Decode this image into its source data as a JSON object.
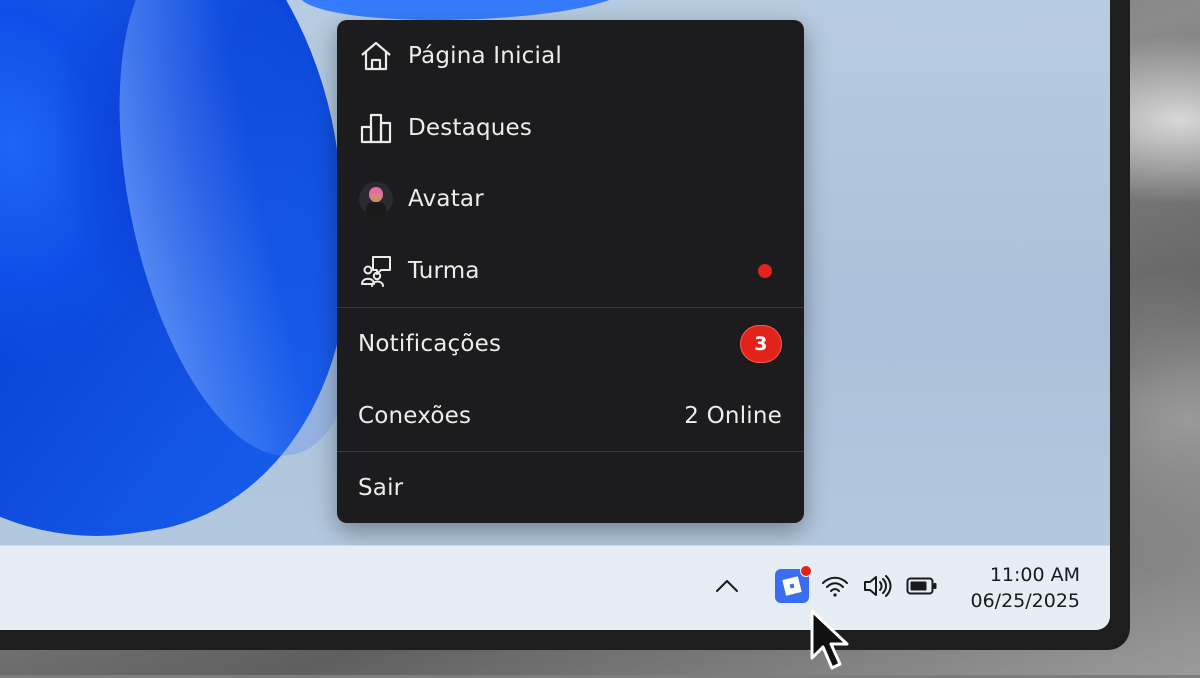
{
  "menu": {
    "items": [
      {
        "label": "Página Inicial",
        "icon": "home-icon"
      },
      {
        "label": "Destaques",
        "icon": "charts-icon"
      },
      {
        "label": "Avatar",
        "icon": "avatar-icon"
      },
      {
        "label": "Turma",
        "icon": "party-icon"
      }
    ],
    "notifications": {
      "label": "Notificações",
      "count": "3"
    },
    "connections": {
      "label": "Conexões",
      "status": "2 Online"
    },
    "logout": {
      "label": "Sair"
    }
  },
  "taskbar": {
    "time": "11:00 AM",
    "date": "06/25/2025",
    "tray": [
      "chevron-up-icon",
      "roblox-icon",
      "wifi-icon",
      "volume-icon",
      "battery-icon"
    ]
  },
  "colors": {
    "menu_bg": "#1c1c1e",
    "badge": "#e2231a",
    "taskbar_bg": "#e6edf5",
    "app_icon": "#3a6df0"
  }
}
